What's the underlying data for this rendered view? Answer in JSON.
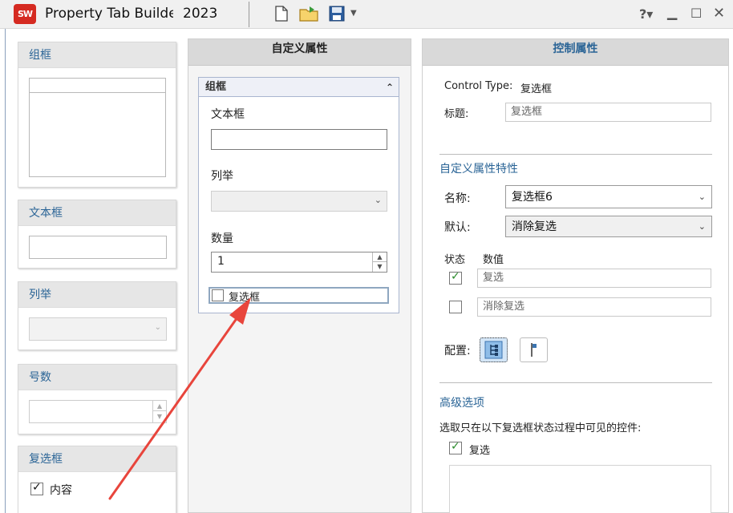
{
  "titlebar": {
    "logo": "SW",
    "title": "Property Tab Builde",
    "year": "2023",
    "help": "?▾"
  },
  "left_panels": {
    "group": {
      "header": "组框"
    },
    "textbox": {
      "header": "文本框"
    },
    "list": {
      "header": "列举"
    },
    "number": {
      "header": "号数"
    },
    "checkbox": {
      "header": "复选框",
      "item_label": "内容",
      "item_checked": true
    }
  },
  "middle": {
    "header": "自定义属性",
    "group_title": "组框",
    "textbox_label": "文本框",
    "textbox_value": "",
    "list_label": "列举",
    "number_label": "数量",
    "number_value": "1",
    "checkbox_label": "复选框",
    "checkbox_checked": false
  },
  "right": {
    "header": "控制属性",
    "control_type_label": "Control Type:",
    "control_type_value": "复选框",
    "caption_label": "标题:",
    "caption_value": "复选框",
    "custom_section": "自定义属性特性",
    "name_label": "名称:",
    "name_value": "复选框6",
    "default_label": "默认:",
    "default_value": "消除复选",
    "state_header": "状态",
    "value_header": "数值",
    "states": [
      {
        "checked": true,
        "value": "复选"
      },
      {
        "checked": false,
        "value": "消除复选"
      }
    ],
    "config_label": "配置:",
    "advanced_section": "高级选项",
    "advanced_desc": "选取只在以下复选框状态过程中可见的控件:",
    "advanced_item_label": "复选",
    "advanced_item_checked": true
  },
  "colors": {
    "accent_blue": "#2a6496",
    "arrow_red": "#e8453c",
    "logo_red": "#d52a21",
    "check_green": "#2a8a2a"
  }
}
